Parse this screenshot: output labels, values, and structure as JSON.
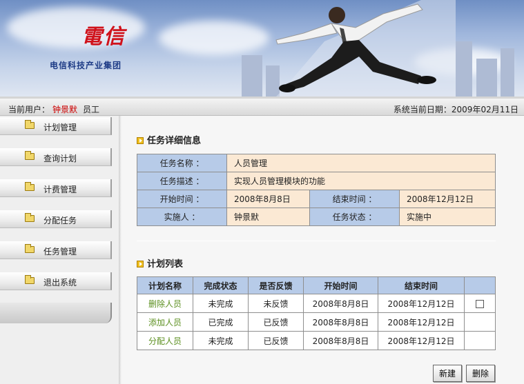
{
  "header": {
    "logo_glyph": "電信",
    "company": "电信科技产业集团"
  },
  "status": {
    "user_label": "当前用户：",
    "user_name": "钟景默",
    "user_role": "员工",
    "date_label": "系统当前日期：",
    "date_value": "2009年02月11日"
  },
  "sidebar": {
    "items": [
      {
        "label": "计划管理"
      },
      {
        "label": "查询计划"
      },
      {
        "label": "计费管理"
      },
      {
        "label": "分配任务"
      },
      {
        "label": "任务管理"
      },
      {
        "label": "退出系统"
      }
    ]
  },
  "detail": {
    "title": "任务详细信息",
    "name_label": "任务名称 ：",
    "name_value": "人员管理",
    "desc_label": "任务描述 ：",
    "desc_value": "实现人员管理模块的功能",
    "start_label": "开始时间 ：",
    "start_value": "2008年8月8日",
    "end_label": "结束时间 ：",
    "end_value": "2008年12月12日",
    "owner_label": "实施人 ：",
    "owner_value": "钟景默",
    "state_label": "任务状态 ：",
    "state_value": "实施中"
  },
  "plans": {
    "title": "计划列表",
    "headers": [
      "计划名称",
      "完成状态",
      "是否反馈",
      "开始时间",
      "结束时间",
      ""
    ],
    "rows": [
      {
        "name": "删除人员",
        "status": "未完成",
        "feedback": "未反馈",
        "start": "2008年8月8日",
        "end": "2008年12月12日",
        "checkbox": true
      },
      {
        "name": "添加人员",
        "status": "已完成",
        "feedback": "已反馈",
        "start": "2008年8月8日",
        "end": "2008年12月12日",
        "checkbox": false
      },
      {
        "name": "分配人员",
        "status": "未完成",
        "feedback": "已反馈",
        "start": "2008年8月8日",
        "end": "2008年12月12日",
        "checkbox": false
      }
    ]
  },
  "buttons": {
    "new_label": "新建",
    "delete_label": "删除"
  },
  "colors": {
    "accent_red": "#d0121b",
    "key_cell": "#b7cbe8",
    "value_cell": "#fbe9d4",
    "link_green": "#5b8f1f"
  }
}
